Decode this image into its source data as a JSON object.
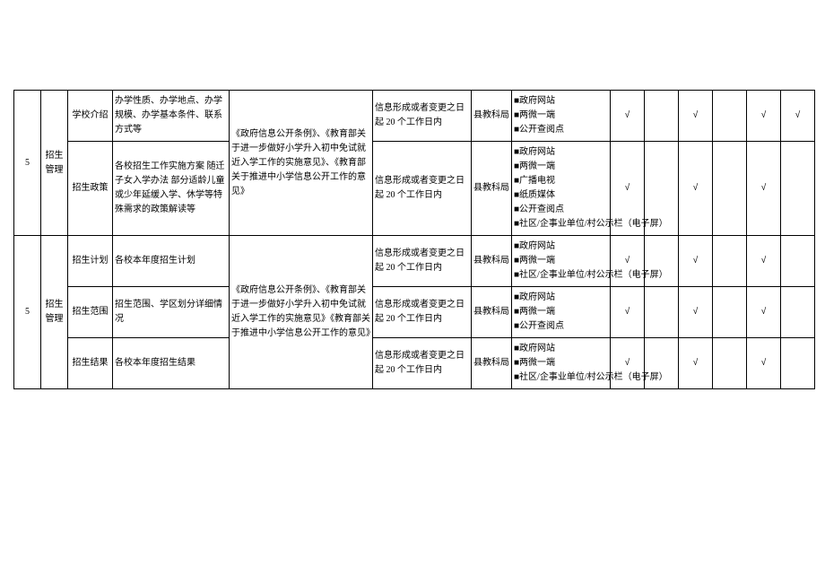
{
  "marker": "■",
  "check": "√",
  "rows": [
    {
      "seq": "5",
      "cat": "招生管理",
      "sub": "学校介绍",
      "content": "办学性质、办学地点、办学规模、办学基本条件、联系方式等",
      "basis": "《政府信息公开条例》、《教育部关于进一步做好小学升入初中免试就近入学工作的实施意见》、《教育部关于推进中小学信息公开工作的意见》",
      "time": "信息形成或者变更之日起 20 个工作日内",
      "dept": "县教科局",
      "channels": [
        "政府网站",
        "两微一端",
        "公开查阅点"
      ],
      "c1": "√",
      "c2": "",
      "c3": "√",
      "c4": "",
      "c5": "√",
      "c6": "√"
    },
    {
      "sub": "招生政策",
      "content": "各校招生工作实施方案 随迁子女入学办法 部分适龄儿童或少年延缓入学、休学等特殊需求的政策解读等",
      "time": "信息形成或者变更之日起 20 个工作日内",
      "dept": "县教科局",
      "channels": [
        "政府网站",
        "两微一端",
        "广播电视",
        "纸质媒体",
        "公开查阅点",
        "社区/企事业单位/村公示栏（电子屏）"
      ],
      "c1": "√",
      "c2": "",
      "c3": "√",
      "c4": "",
      "c5": "√",
      "c6": ""
    },
    {
      "seq": "5",
      "cat": "招生管理",
      "sub": "招生计划",
      "content": "各校本年度招生计划",
      "basis": "《政府信息公开条例》、《教育部关于进一步做好小学升入初中免试就近入学工作的实施意见》《教育部关于推进中小学信息公开工作的意见》",
      "time": "信息形成或者变更之日起 20 个工作日内",
      "dept": "县教科局",
      "channels": [
        "政府网站",
        "两微一端",
        "社区/企事业单位/村公示栏（电子屏）"
      ],
      "c1": "√",
      "c2": "",
      "c3": "√",
      "c4": "",
      "c5": "√",
      "c6": ""
    },
    {
      "sub": "招生范围",
      "content": "招生范围、学区划分详细情况",
      "time": "信息形成或者变更之日起 20 个工作日内",
      "dept": "县教科局",
      "channels": [
        "政府网站",
        "两微一端",
        "公开查阅点"
      ],
      "c1": "√",
      "c2": "",
      "c3": "√",
      "c4": "",
      "c5": "√",
      "c6": ""
    },
    {
      "sub": "招生结果",
      "content": "各校本年度招生结果",
      "time": "信息形成或者变更之日起 20 个工作日内",
      "dept": "县教科局",
      "channels": [
        "政府网站",
        "两微一端",
        "社区/企事业单位/村公示栏（电子屏）"
      ],
      "c1": "√",
      "c2": "",
      "c3": "√",
      "c4": "",
      "c5": "√",
      "c6": ""
    }
  ]
}
